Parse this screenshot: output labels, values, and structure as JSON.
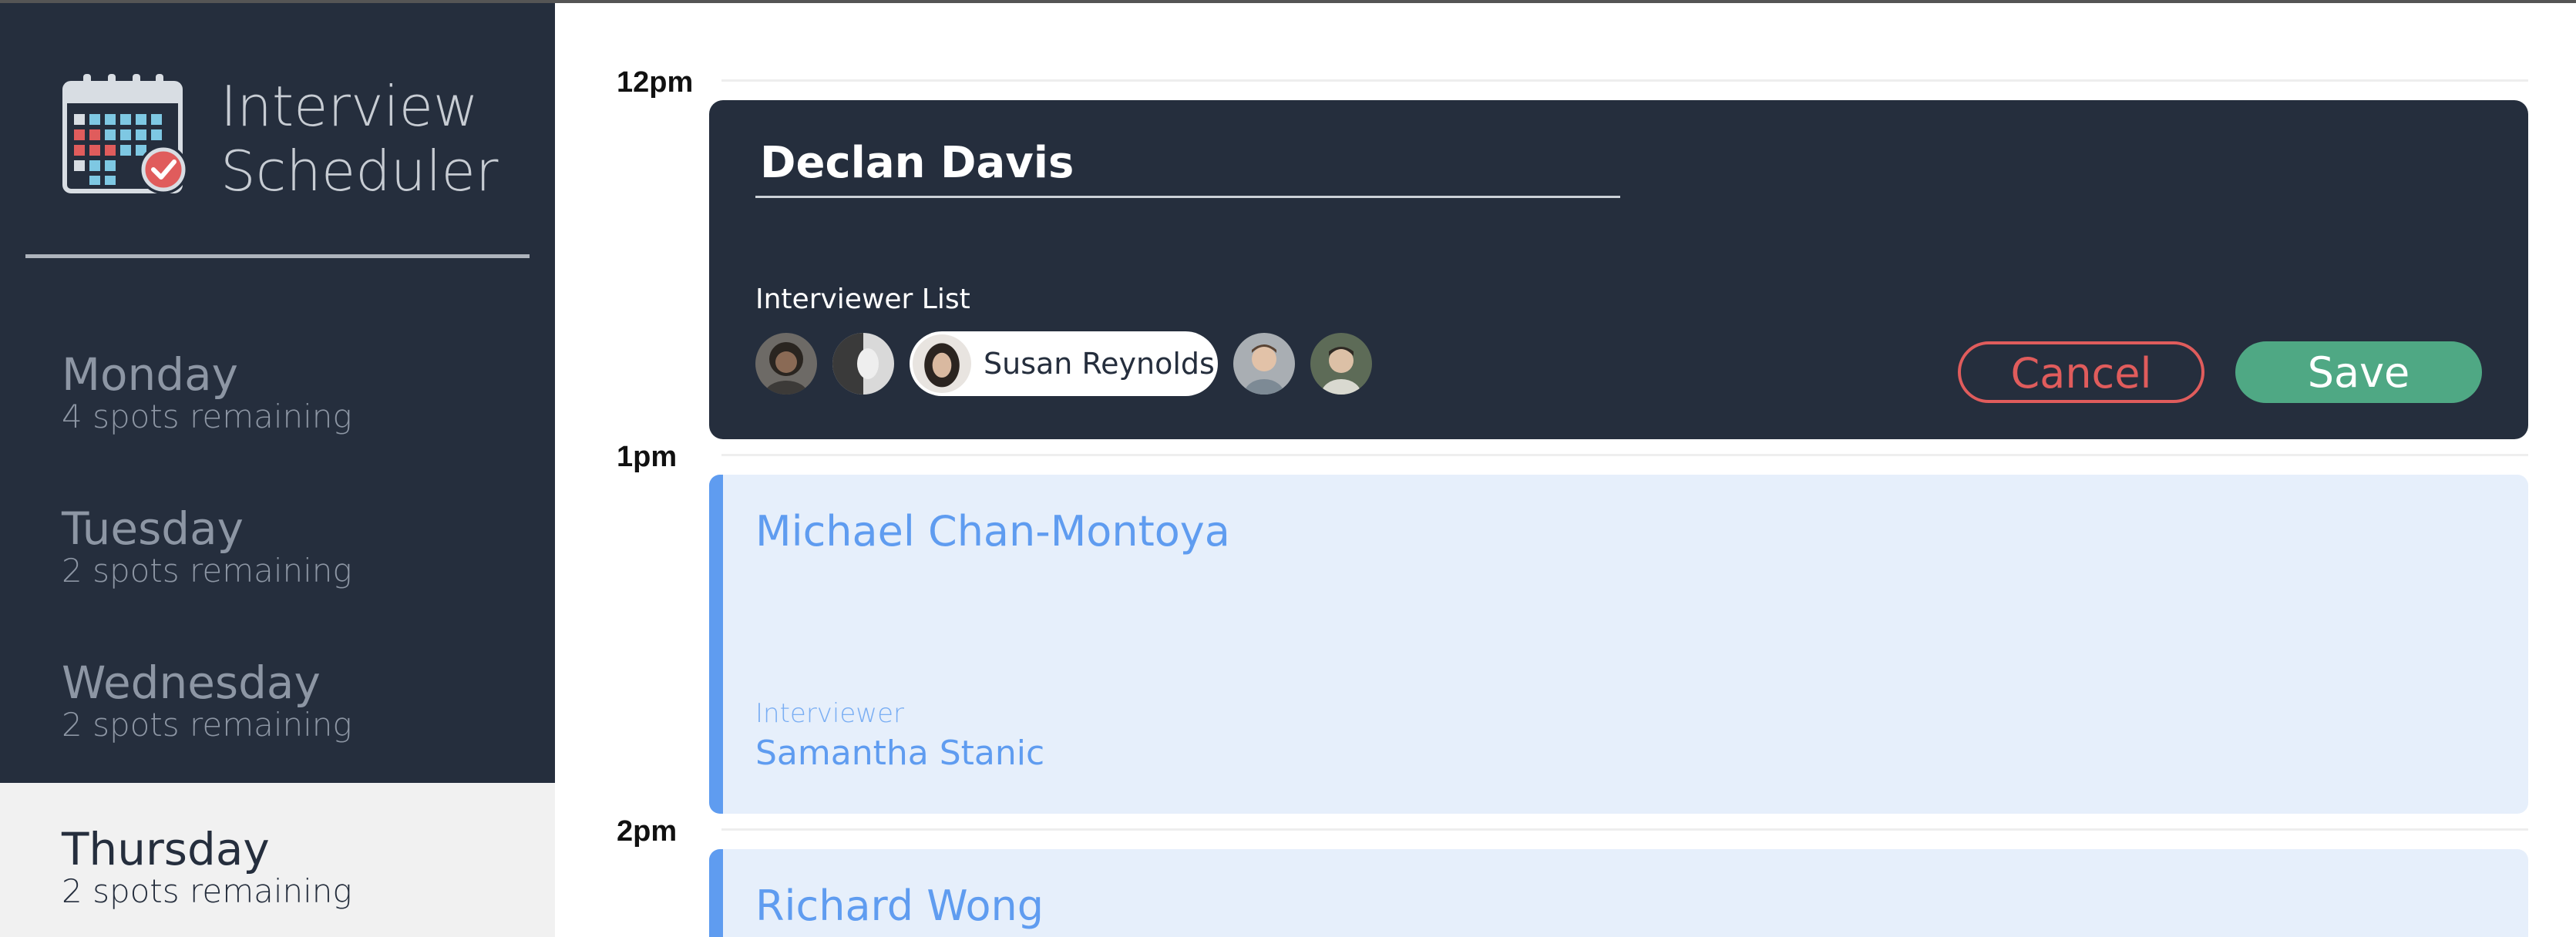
{
  "app": {
    "title_line1": "Interview",
    "title_line2": "Scheduler"
  },
  "sidebar": {
    "days": [
      {
        "name": "Monday",
        "spots": "4 spots remaining",
        "selected": false
      },
      {
        "name": "Tuesday",
        "spots": "2 spots remaining",
        "selected": false
      },
      {
        "name": "Wednesday",
        "spots": "2 spots remaining",
        "selected": false
      },
      {
        "name": "Thursday",
        "spots": "2 spots remaining",
        "selected": true
      }
    ]
  },
  "schedule": {
    "times": [
      "12pm",
      "1pm",
      "2pm"
    ],
    "form": {
      "student_name": "Declan Davis",
      "interviewer_list_label": "Interviewer List",
      "selected_interviewer": "Susan Reynolds",
      "cancel_label": "Cancel",
      "save_label": "Save"
    },
    "appointments": [
      {
        "student": "Michael Chan-Montoya",
        "interviewer_label": "Interviewer",
        "interviewer": "Samantha Stanic"
      },
      {
        "student": "Richard Wong"
      }
    ]
  },
  "colors": {
    "sidebar_bg": "#252e3d",
    "accent_blue": "#5f9cf0",
    "appointment_bg": "#e6effb",
    "danger": "#e05c5c",
    "success": "#4fa884"
  }
}
